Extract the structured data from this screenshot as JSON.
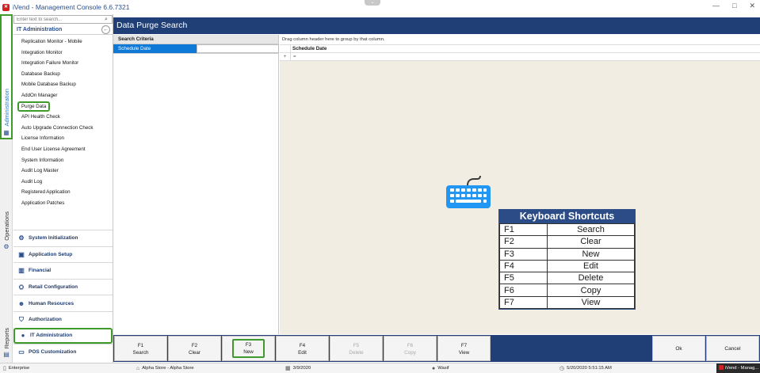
{
  "window": {
    "title": "iVend - Management Console  6.6.7321",
    "app_icon": "ivend-logo-icon",
    "controls": [
      "—",
      "□",
      "✕"
    ]
  },
  "vertical_tabs": [
    {
      "label": "Administration",
      "icon": "grid-icon"
    },
    {
      "label": "Operations",
      "icon": "gear-icon"
    },
    {
      "label": "Reports",
      "icon": "report-icon"
    }
  ],
  "sidebar": {
    "search_placeholder": "Enter text to search...",
    "section_title": "IT Administration",
    "items": [
      {
        "label": "Replication Monitor - Mobile"
      },
      {
        "label": "Integration Monitor"
      },
      {
        "label": "Integration Failure Monitor"
      },
      {
        "label": "Database Backup"
      },
      {
        "label": "Mobile Database Backup"
      },
      {
        "label": "AddOn Manager"
      },
      {
        "label": "Purge Data",
        "active": true
      },
      {
        "label": "API Health Check"
      },
      {
        "label": "Auto Upgrade Connection Check"
      },
      {
        "label": "License Information"
      },
      {
        "label": "End User License Agreement"
      },
      {
        "label": "System Information"
      },
      {
        "label": "Audit Log Master"
      },
      {
        "label": "Audit Log"
      },
      {
        "label": "Registered Application"
      },
      {
        "label": "Application Patches"
      }
    ],
    "modules": [
      {
        "label": "System Initialization",
        "icon": "system-icon"
      },
      {
        "label": "Application Setup",
        "icon": "setup-icon"
      },
      {
        "label": "Financial",
        "icon": "financial-icon"
      },
      {
        "label": "Retail Configuration",
        "icon": "retail-icon"
      },
      {
        "label": "Human Resources",
        "icon": "people-icon"
      },
      {
        "label": "Authorization",
        "icon": "shield-icon"
      },
      {
        "label": "IT Administration",
        "icon": "user-icon",
        "selected": true
      },
      {
        "label": "POS Customization",
        "icon": "pos-icon"
      }
    ]
  },
  "main": {
    "title": "Data Purge Search",
    "criteria_header": "Search Criteria",
    "criteria_field": "Schedule Date",
    "criteria_value": "",
    "grid_group_hint": "Drag column header here to group by that column.",
    "grid_column": "Schedule Date",
    "filter_marker": "+",
    "filter_operator": "="
  },
  "shortcuts": {
    "title": "Keyboard Shortcuts",
    "rows": [
      {
        "key": "F1",
        "action": "Search"
      },
      {
        "key": "F2",
        "action": "Clear"
      },
      {
        "key": "F3",
        "action": "New"
      },
      {
        "key": "F4",
        "action": "Edit"
      },
      {
        "key": "F5",
        "action": "Delete"
      },
      {
        "key": "F6",
        "action": "Copy"
      },
      {
        "key": "F7",
        "action": "View"
      }
    ]
  },
  "function_keys": [
    {
      "key": "F1",
      "label": "Search",
      "enabled": true
    },
    {
      "key": "F2",
      "label": "Clear",
      "enabled": true
    },
    {
      "key": "F3",
      "label": "New",
      "enabled": true,
      "highlight": true
    },
    {
      "key": "F4",
      "label": "Edit",
      "enabled": true
    },
    {
      "key": "F5",
      "label": "Delete",
      "enabled": false
    },
    {
      "key": "F6",
      "label": "Copy",
      "enabled": false
    },
    {
      "key": "F7",
      "label": "View",
      "enabled": true
    }
  ],
  "actions": {
    "ok": "Ok",
    "cancel": "Cancel"
  },
  "status": {
    "company": "Enterprise",
    "store": "Alpha Store - Alpha Store",
    "date": "3/9/2020",
    "user": "Wasif",
    "datetime": "5/20/2020 5:51:15 AM",
    "taskbar": "iVend - Manag..."
  },
  "colors": {
    "header_blue": "#1f3f76",
    "selection_blue": "#0f79d8",
    "highlight_green": "#3e9a2b",
    "grid_background": "#f2ede2"
  }
}
